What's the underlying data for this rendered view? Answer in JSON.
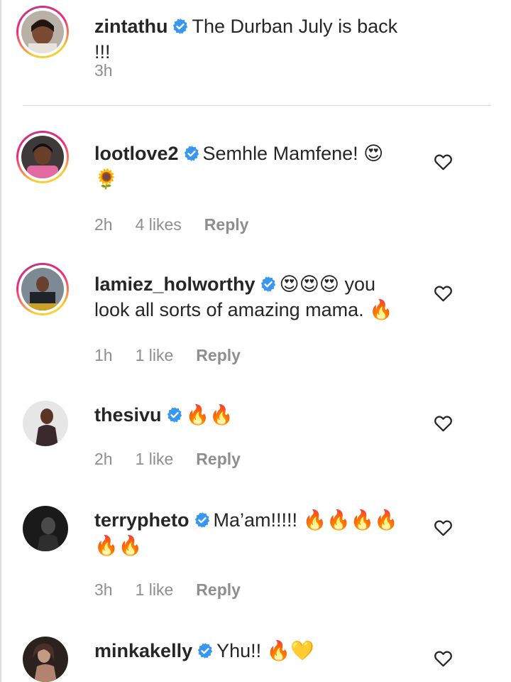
{
  "caption": {
    "username": "zintathu",
    "text": "The Durban July is back !!!",
    "time": "3h"
  },
  "comments": [
    {
      "username": "lootlove2",
      "text": "Semhle Mamfene! 😍 🌻",
      "time": "2h",
      "likes": "4 likes",
      "reply": "Reply"
    },
    {
      "username": "lamiez_holworthy",
      "text": "😍😍😍 you look all sorts of amazing mama. 🔥",
      "time": "1h",
      "likes": "1 like",
      "reply": "Reply"
    },
    {
      "username": "thesivu",
      "text": "🔥🔥",
      "time": "2h",
      "likes": "1 like",
      "reply": "Reply"
    },
    {
      "username": "terrypheto",
      "text": "Ma’am!!!!! 🔥🔥🔥🔥 🔥🔥",
      "time": "3h",
      "likes": "1 like",
      "reply": "Reply"
    },
    {
      "username": "minkakelly",
      "text": "Yhu!! 🔥💛",
      "time": "",
      "likes": "",
      "reply": ""
    }
  ],
  "colors": {
    "verified": "#3897f0",
    "secondary_text": "#8e8e8e",
    "primary_text": "#262626"
  },
  "icons": [
    "verified-badge-icon",
    "heart-outline-icon"
  ]
}
